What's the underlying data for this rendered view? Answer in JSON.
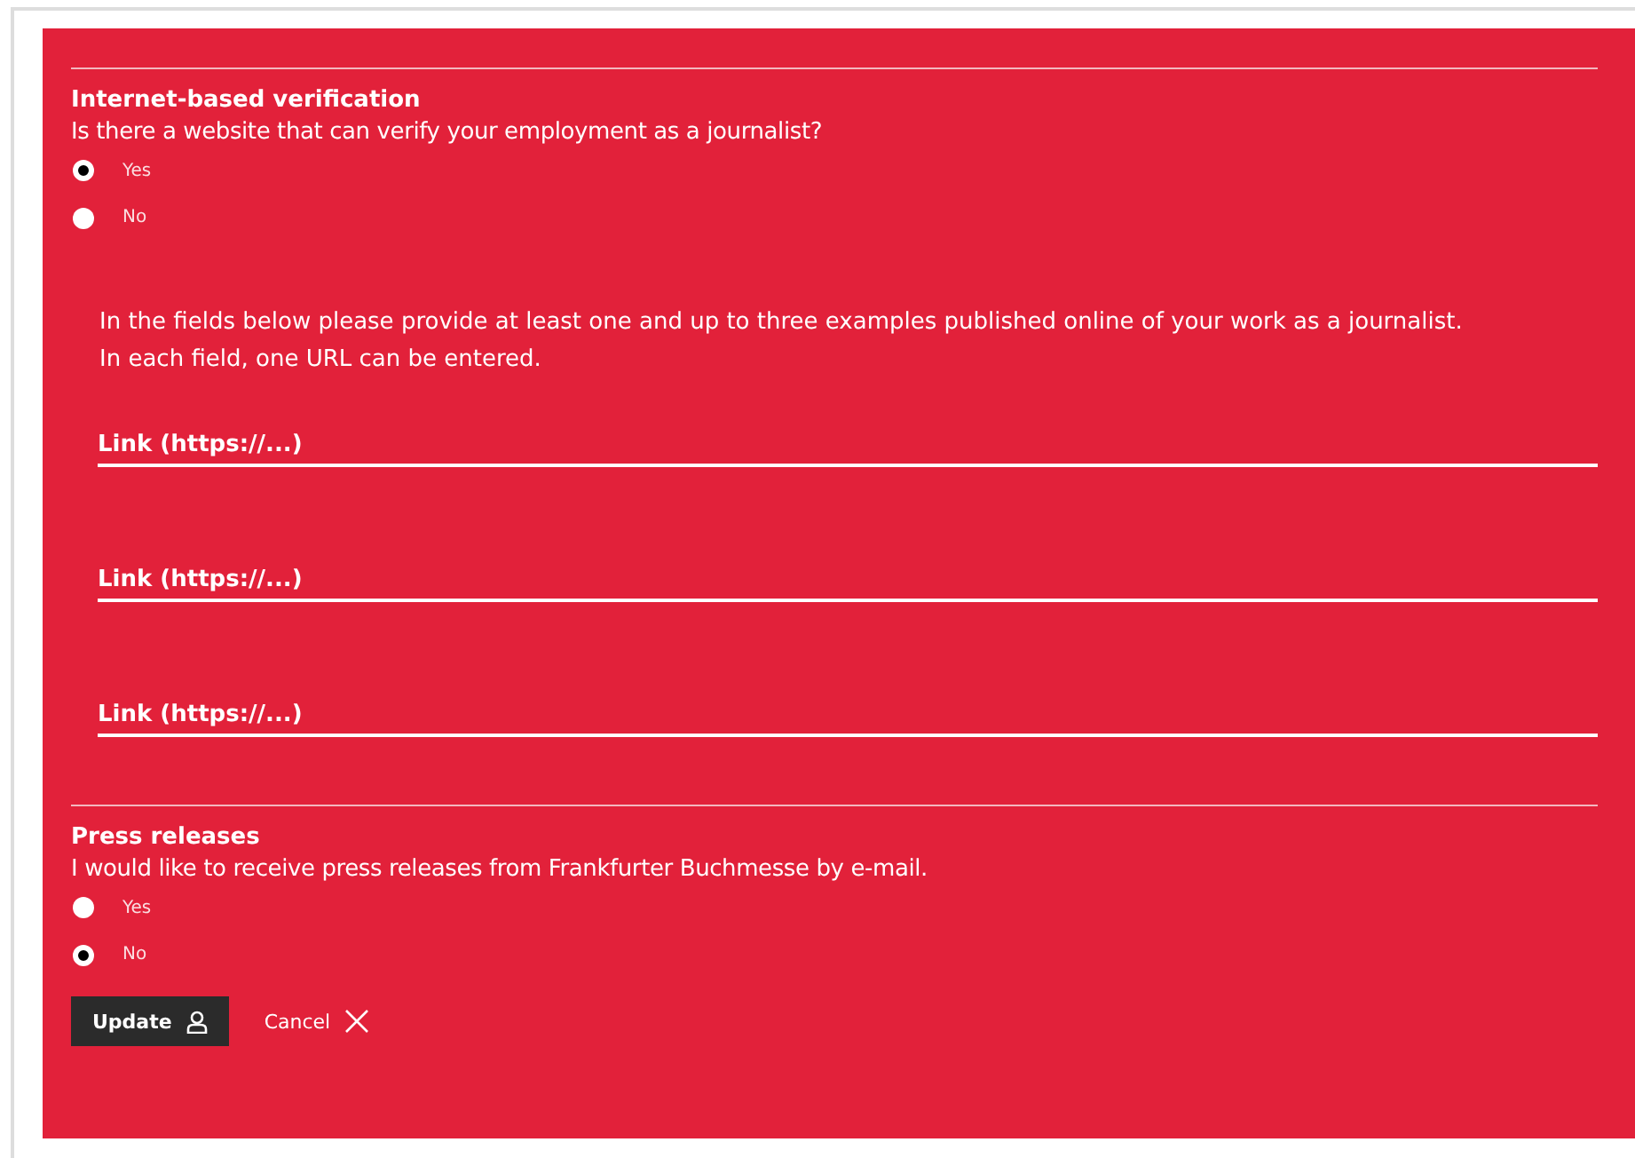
{
  "sections": [
    {
      "heading": "Internet-based verification",
      "question": "Is there a website that can verify your employment as a journalist?",
      "options": [
        {
          "label": "Yes",
          "selected": true
        },
        {
          "label": "No",
          "selected": false
        }
      ],
      "instructions": [
        "In the fields below please provide at least one and up to three examples published online of your work as a journalist.",
        "In each field, one URL can be entered."
      ],
      "fields": [
        {
          "placeholder": "Link (https://...)"
        },
        {
          "placeholder": "Link (https://...)"
        },
        {
          "placeholder": "Link (https://...)"
        }
      ]
    },
    {
      "heading": "Press releases",
      "question": "I would like to receive press releases from Frankfurter Buchmesse by e-mail.",
      "options": [
        {
          "label": "Yes",
          "selected": false
        },
        {
          "label": "No",
          "selected": true
        }
      ]
    }
  ],
  "actions": [
    {
      "kind": "primary",
      "label": "Update"
    },
    {
      "kind": "secondary",
      "label": "Cancel"
    }
  ]
}
